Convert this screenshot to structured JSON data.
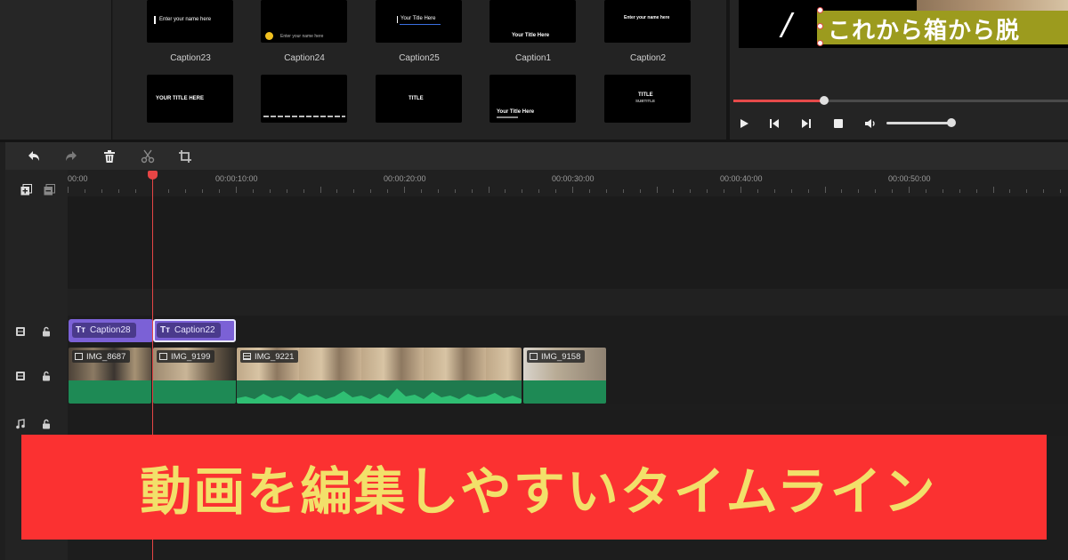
{
  "templates": [
    {
      "label": "Caption23",
      "thumb_text": "Enter your name here"
    },
    {
      "label": "Caption24",
      "thumb_text": "Enter your name here"
    },
    {
      "label": "Caption25",
      "thumb_text": "Your Title Here"
    },
    {
      "label": "Caption1",
      "thumb_text": "Your Title Here"
    },
    {
      "label": "Caption2",
      "thumb_text": "Enter your name here"
    },
    {
      "label": "",
      "thumb_text": "YOUR TITLE HERE"
    },
    {
      "label": "",
      "thumb_text": ""
    },
    {
      "label": "",
      "thumb_text": "TITLE"
    },
    {
      "label": "",
      "thumb_text": "Your Title Here"
    },
    {
      "label": "",
      "thumb_text": "TITLE",
      "thumb_subtext": "SUBTITLE"
    }
  ],
  "preview": {
    "caption_text": "これから箱から脱",
    "progress": 0.27,
    "volume": 0.95
  },
  "ruler": {
    "labels": [
      "00:00",
      "00:00:10:00",
      "00:00:20:00",
      "00:00:30:00",
      "00:00:40:00",
      "00:00:50:00"
    ]
  },
  "playhead_time_sec": 5,
  "text_clips": [
    {
      "label": "Caption28",
      "selected": false
    },
    {
      "label": "Caption22",
      "selected": true
    }
  ],
  "video_clips": [
    {
      "label": "IMG_8687",
      "type": "image"
    },
    {
      "label": "IMG_9199",
      "type": "image"
    },
    {
      "label": "IMG_9221",
      "type": "video"
    },
    {
      "label": "IMG_9158",
      "type": "image"
    }
  ],
  "banner": {
    "text": "動画を編集しやすいタイムライン",
    "background": "#fb3131",
    "text_color": "#f2e06a"
  },
  "colors": {
    "accent": "#e64545",
    "caption_clip": "#7b61d6",
    "audio_wave": "#1e8a55"
  }
}
